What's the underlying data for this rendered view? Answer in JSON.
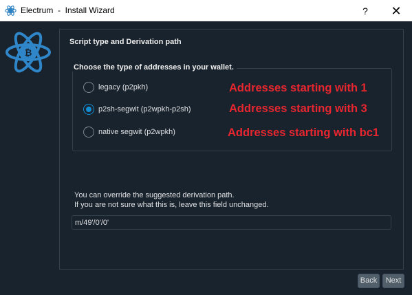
{
  "window": {
    "title": "Electrum  -  Install Wizard",
    "help_glyph": "?",
    "close_glyph": "✕"
  },
  "panel": {
    "title": "Script type and Derivation path"
  },
  "address_group": {
    "title": "Choose the type of addresses in your wallet.",
    "options": [
      {
        "label": "legacy (p2pkh)",
        "selected": false
      },
      {
        "label": "p2sh-segwit (p2wpkh-p2sh)",
        "selected": true
      },
      {
        "label": "native segwit (p2wpkh)",
        "selected": false
      }
    ]
  },
  "annotations": [
    "Addresses starting with 1",
    "Addresses starting with 3",
    "Addresses starting with bc1"
  ],
  "derivation": {
    "hint_line1": "You can override the suggested derivation path.",
    "hint_line2": "If you are not sure what this is, leave this field unchanged.",
    "value": "m/49'/0'/0'"
  },
  "buttons": {
    "back": "Back",
    "next": "Next"
  },
  "colors": {
    "background": "#19232d",
    "accent": "#148cd2",
    "annotation": "#e8262f"
  }
}
